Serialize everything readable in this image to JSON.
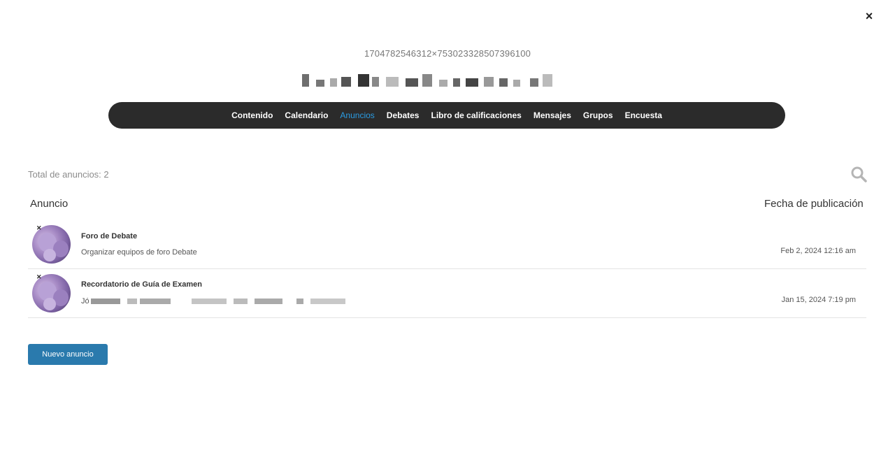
{
  "modal": {
    "close_label": "×",
    "course_code": "1704782546312×753023328507396100"
  },
  "nav": {
    "items": [
      {
        "label": "Contenido",
        "active": false
      },
      {
        "label": "Calendario",
        "active": false
      },
      {
        "label": "Anuncios",
        "active": true
      },
      {
        "label": "Debates",
        "active": false
      },
      {
        "label": "Libro de calificaciones",
        "active": false
      },
      {
        "label": "Mensajes",
        "active": false
      },
      {
        "label": "Grupos",
        "active": false
      },
      {
        "label": "Encuesta",
        "active": false
      }
    ],
    "active_color": "#2b9ce3",
    "background": "#2b2b2b"
  },
  "toolbar": {
    "total_label": "Total de anuncios: 2",
    "search_icon": "search-icon"
  },
  "table": {
    "col_announcement": "Anuncio",
    "col_date": "Fecha de publicación",
    "rows": [
      {
        "title": "Foro de Debate",
        "description": "Organizar equipos de foro Debate",
        "date": "Feb 2, 2024 12:16 am"
      },
      {
        "title": "Recordatorio de Guía de Examen",
        "description": "Jó",
        "date": "Jan 15, 2024 7:19 pm"
      }
    ]
  },
  "actions": {
    "new_button_label": "Nuevo anuncio",
    "button_color": "#2a7aad"
  }
}
